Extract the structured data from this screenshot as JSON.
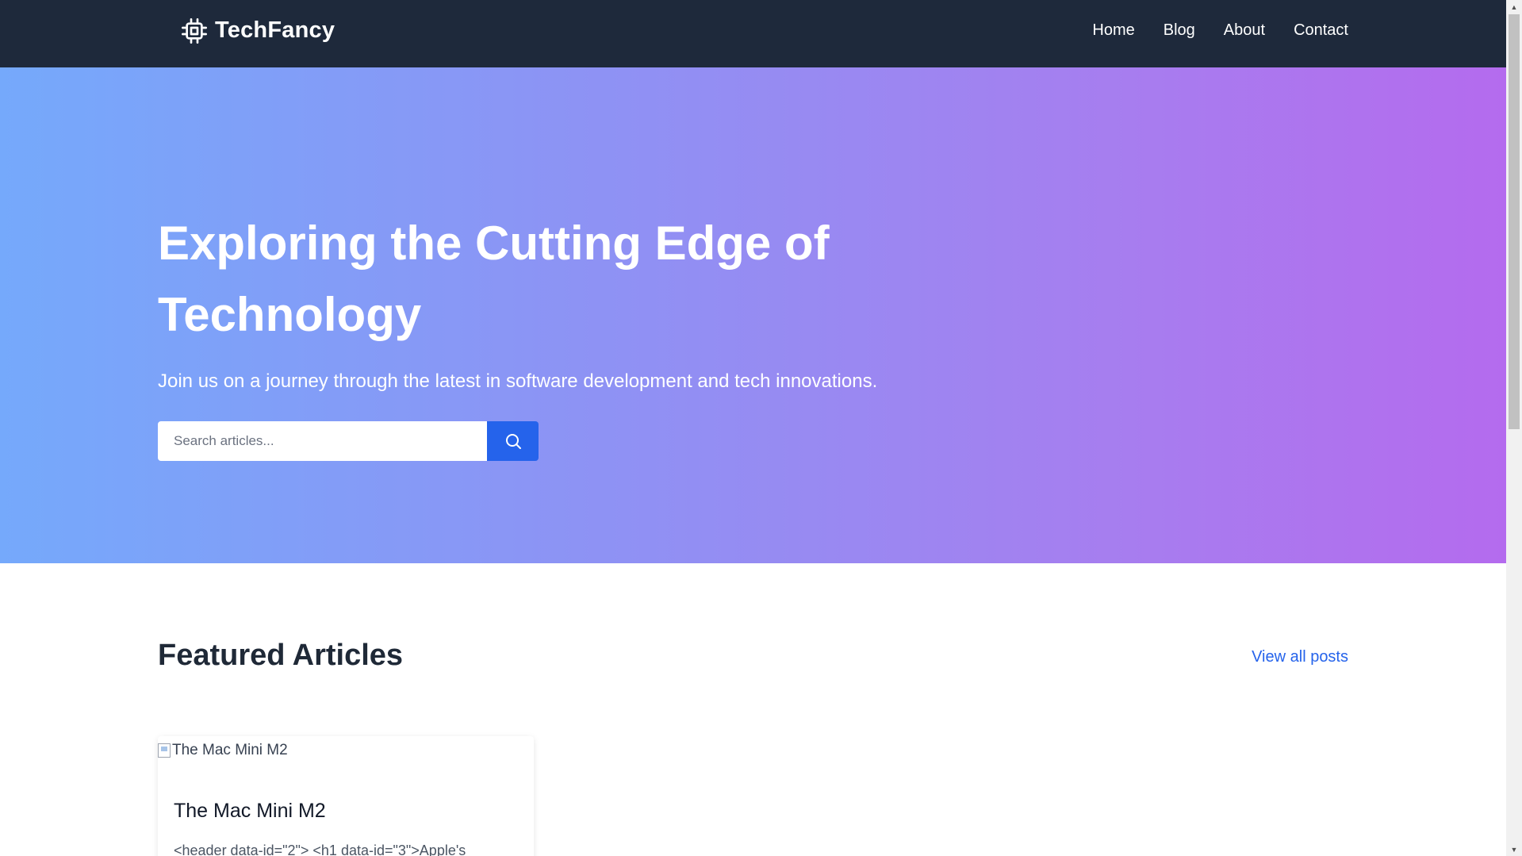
{
  "nav": {
    "brand": "TechFancy",
    "brand_icon": "cpu-chip-icon",
    "links": [
      "Home",
      "Blog",
      "About",
      "Contact"
    ]
  },
  "hero": {
    "title": "Exploring the Cutting Edge of Technology",
    "subtitle": "Join us on a journey through the latest in software development and tech innovations.",
    "search_placeholder": "Search articles...",
    "search_icon": "search-icon"
  },
  "featured": {
    "title": "Featured Articles",
    "view_all": "View all posts",
    "cards": [
      {
        "image_alt": "The Mac Mini M2",
        "title": "The Mac Mini M2",
        "excerpt": "<header data-id=\"2\"> <h1 data-id=\"3\">Apple's"
      }
    ]
  },
  "colors": {
    "nav_bg": "#1e293b",
    "hero_gradient_start": "#75a9fb",
    "hero_gradient_end": "#b46bee",
    "accent": "#2563eb"
  }
}
